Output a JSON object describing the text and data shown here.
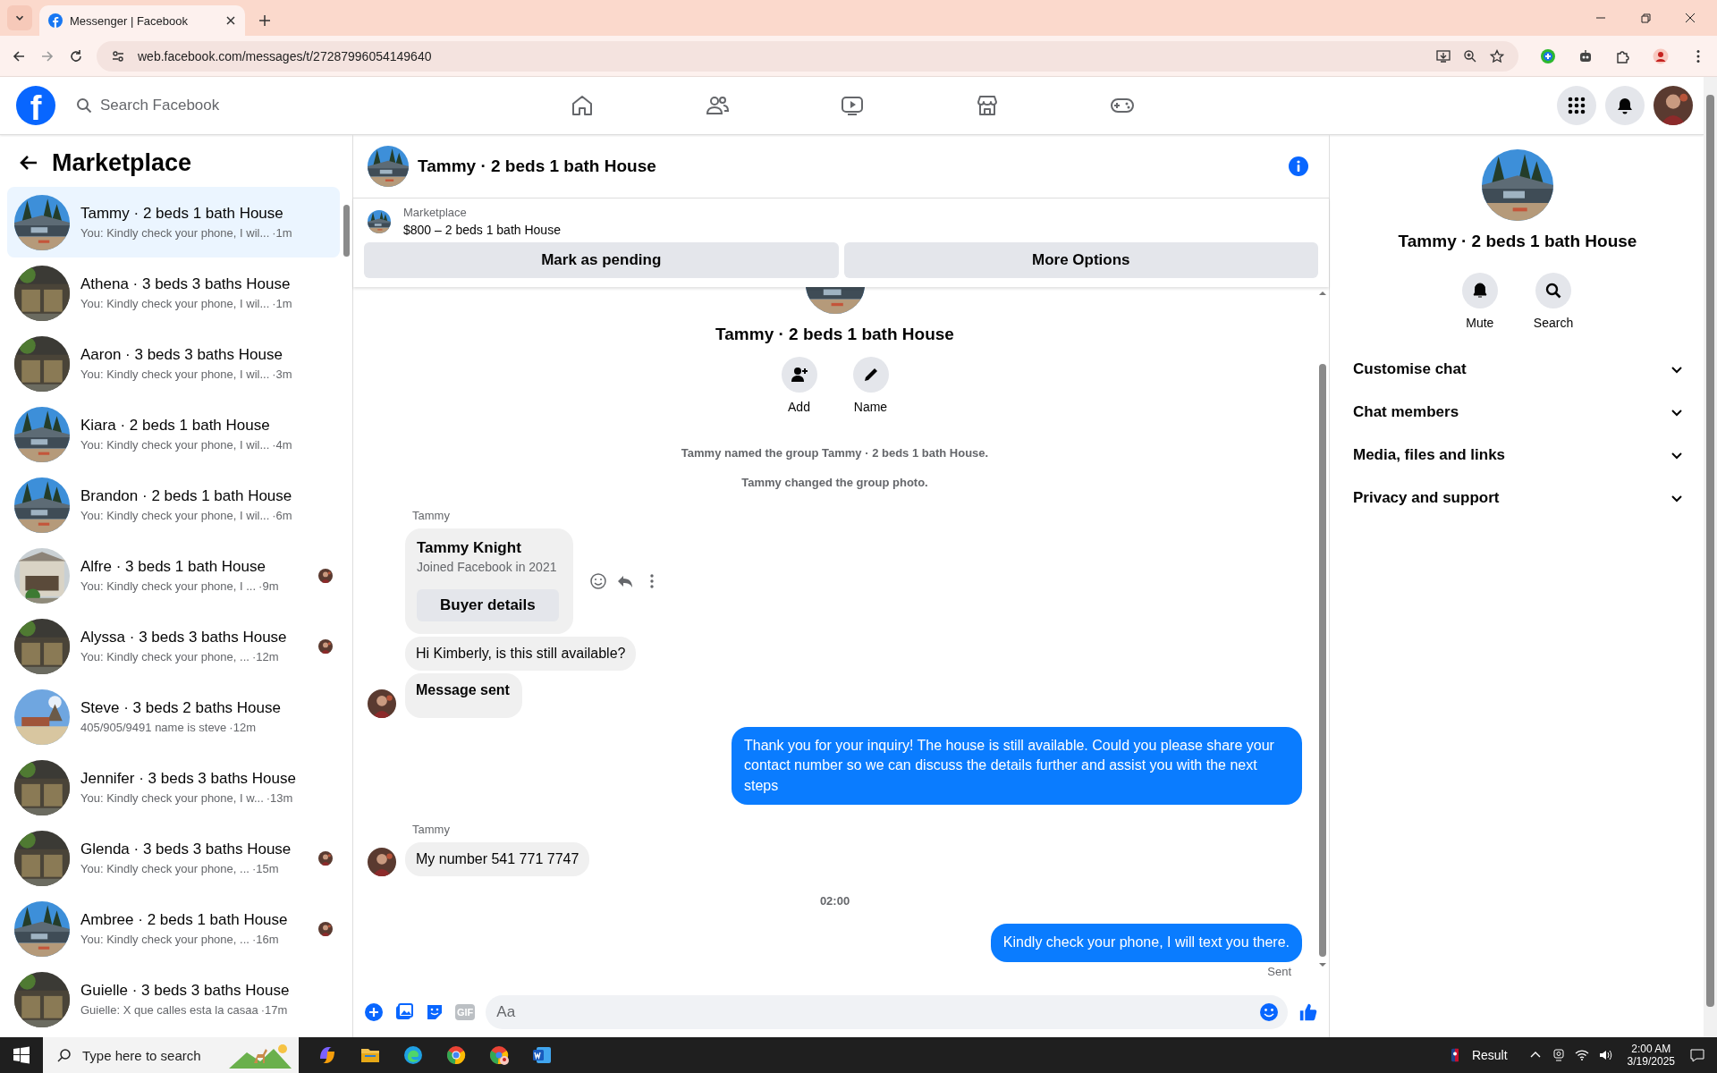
{
  "browser": {
    "tab_title": "Messenger | Facebook",
    "url": "web.facebook.com/messages/t/27287996054149640"
  },
  "topbar": {
    "logo": "f",
    "search_placeholder": "Search Facebook"
  },
  "sidebar": {
    "title": "Marketplace",
    "threads": [
      {
        "name": "Tammy · 2 beds 1 bath House",
        "preview": "You: Kindly check your phone, I wil...",
        "time": "·1m",
        "selected": true,
        "seen": false
      },
      {
        "name": "Athena · 3 beds 3 baths House",
        "preview": "You: Kindly check your phone, I wil...",
        "time": "·1m",
        "selected": false,
        "seen": false
      },
      {
        "name": "Aaron · 3 beds 3 baths House",
        "preview": "You: Kindly check your phone, I wil...",
        "time": "·3m",
        "selected": false,
        "seen": false
      },
      {
        "name": "Kiara · 2 beds 1 bath House",
        "preview": "You: Kindly check your phone, I wil...",
        "time": "·4m",
        "selected": false,
        "seen": false
      },
      {
        "name": "Brandon · 2 beds 1 bath House",
        "preview": "You: Kindly check your phone, I wil...",
        "time": "·6m",
        "selected": false,
        "seen": false
      },
      {
        "name": "Alfre · 3 beds 1 bath House",
        "preview": "You: Kindly check your phone, I ...",
        "time": "·9m",
        "selected": false,
        "seen": true
      },
      {
        "name": "Alyssa · 3 beds 3 baths House",
        "preview": "You: Kindly check your phone, ...",
        "time": "·12m",
        "selected": false,
        "seen": true
      },
      {
        "name": "Steve · 3 beds 2 baths House",
        "preview": "405/905/9491 name is steve",
        "time": "·12m",
        "selected": false,
        "seen": false
      },
      {
        "name": "Jennifer · 3 beds 3 baths House",
        "preview": "You: Kindly check your phone, I w...",
        "time": "·13m",
        "selected": false,
        "seen": false
      },
      {
        "name": "Glenda · 3 beds 3 baths House",
        "preview": "You: Kindly check your phone, ...",
        "time": "·15m",
        "selected": false,
        "seen": true
      },
      {
        "name": "Ambree · 2 beds 1 bath House",
        "preview": "You: Kindly check your phone, ...",
        "time": "·16m",
        "selected": false,
        "seen": true
      },
      {
        "name": "Guielle · 3 beds 3 baths House",
        "preview": "Guielle: X que calles esta la casaa",
        "time": "·17m",
        "selected": false,
        "seen": false
      }
    ]
  },
  "chat": {
    "title": "Tammy · 2 beds 1 bath House",
    "listing": {
      "label": "Marketplace",
      "item": "$800 – 2 beds 1 bath House",
      "buttons": [
        "Mark as pending",
        "More Options"
      ]
    },
    "group_name": "Tammy · 2 beds 1 bath House",
    "group_actions": [
      "Add",
      "Name"
    ],
    "timeline": [
      {
        "kind": "event",
        "text": "Tammy named the group Tammy · 2 beds 1 bath House."
      },
      {
        "kind": "event",
        "text": "Tammy changed the group photo."
      },
      {
        "kind": "sender",
        "text": "Tammy"
      },
      {
        "kind": "card",
        "name": "Tammy Knight",
        "subtitle": "Joined Facebook in 2021",
        "button": "Buyer details"
      },
      {
        "kind": "incoming",
        "text": "Hi Kimberly, is this still available?",
        "bold": false,
        "avatar": false
      },
      {
        "kind": "incoming",
        "text": "Message sent",
        "bold": true,
        "avatar": true
      },
      {
        "kind": "outgoing",
        "text": "Thank you for your inquiry! The house is still available. Could you please share your contact number so we can discuss the details further and assist you with the next steps"
      },
      {
        "kind": "sender",
        "text": "Tammy"
      },
      {
        "kind": "incoming",
        "text": "My number 541 771 7747",
        "bold": false,
        "avatar": true
      },
      {
        "kind": "time",
        "text": "02:00"
      },
      {
        "kind": "outgoing",
        "text": "Kindly check your phone, I will text you there.",
        "status": "Sent"
      }
    ],
    "composer": {
      "gif_label": "GIF",
      "placeholder": "Aa"
    }
  },
  "details": {
    "title": "Tammy · 2 beds 1 bath House",
    "actions": [
      "Mute",
      "Search"
    ],
    "sections": [
      {
        "label": "Customise chat",
        "expanded": false
      },
      {
        "label": "Chat members",
        "expanded": false
      },
      {
        "label": "Media, files and links",
        "expanded": false
      },
      {
        "label": "Privacy and support",
        "expanded": false
      }
    ]
  },
  "taskbar": {
    "search_placeholder": "Type here to search",
    "widget": "Result",
    "time": "2:00 AM",
    "date": "3/19/2025"
  }
}
